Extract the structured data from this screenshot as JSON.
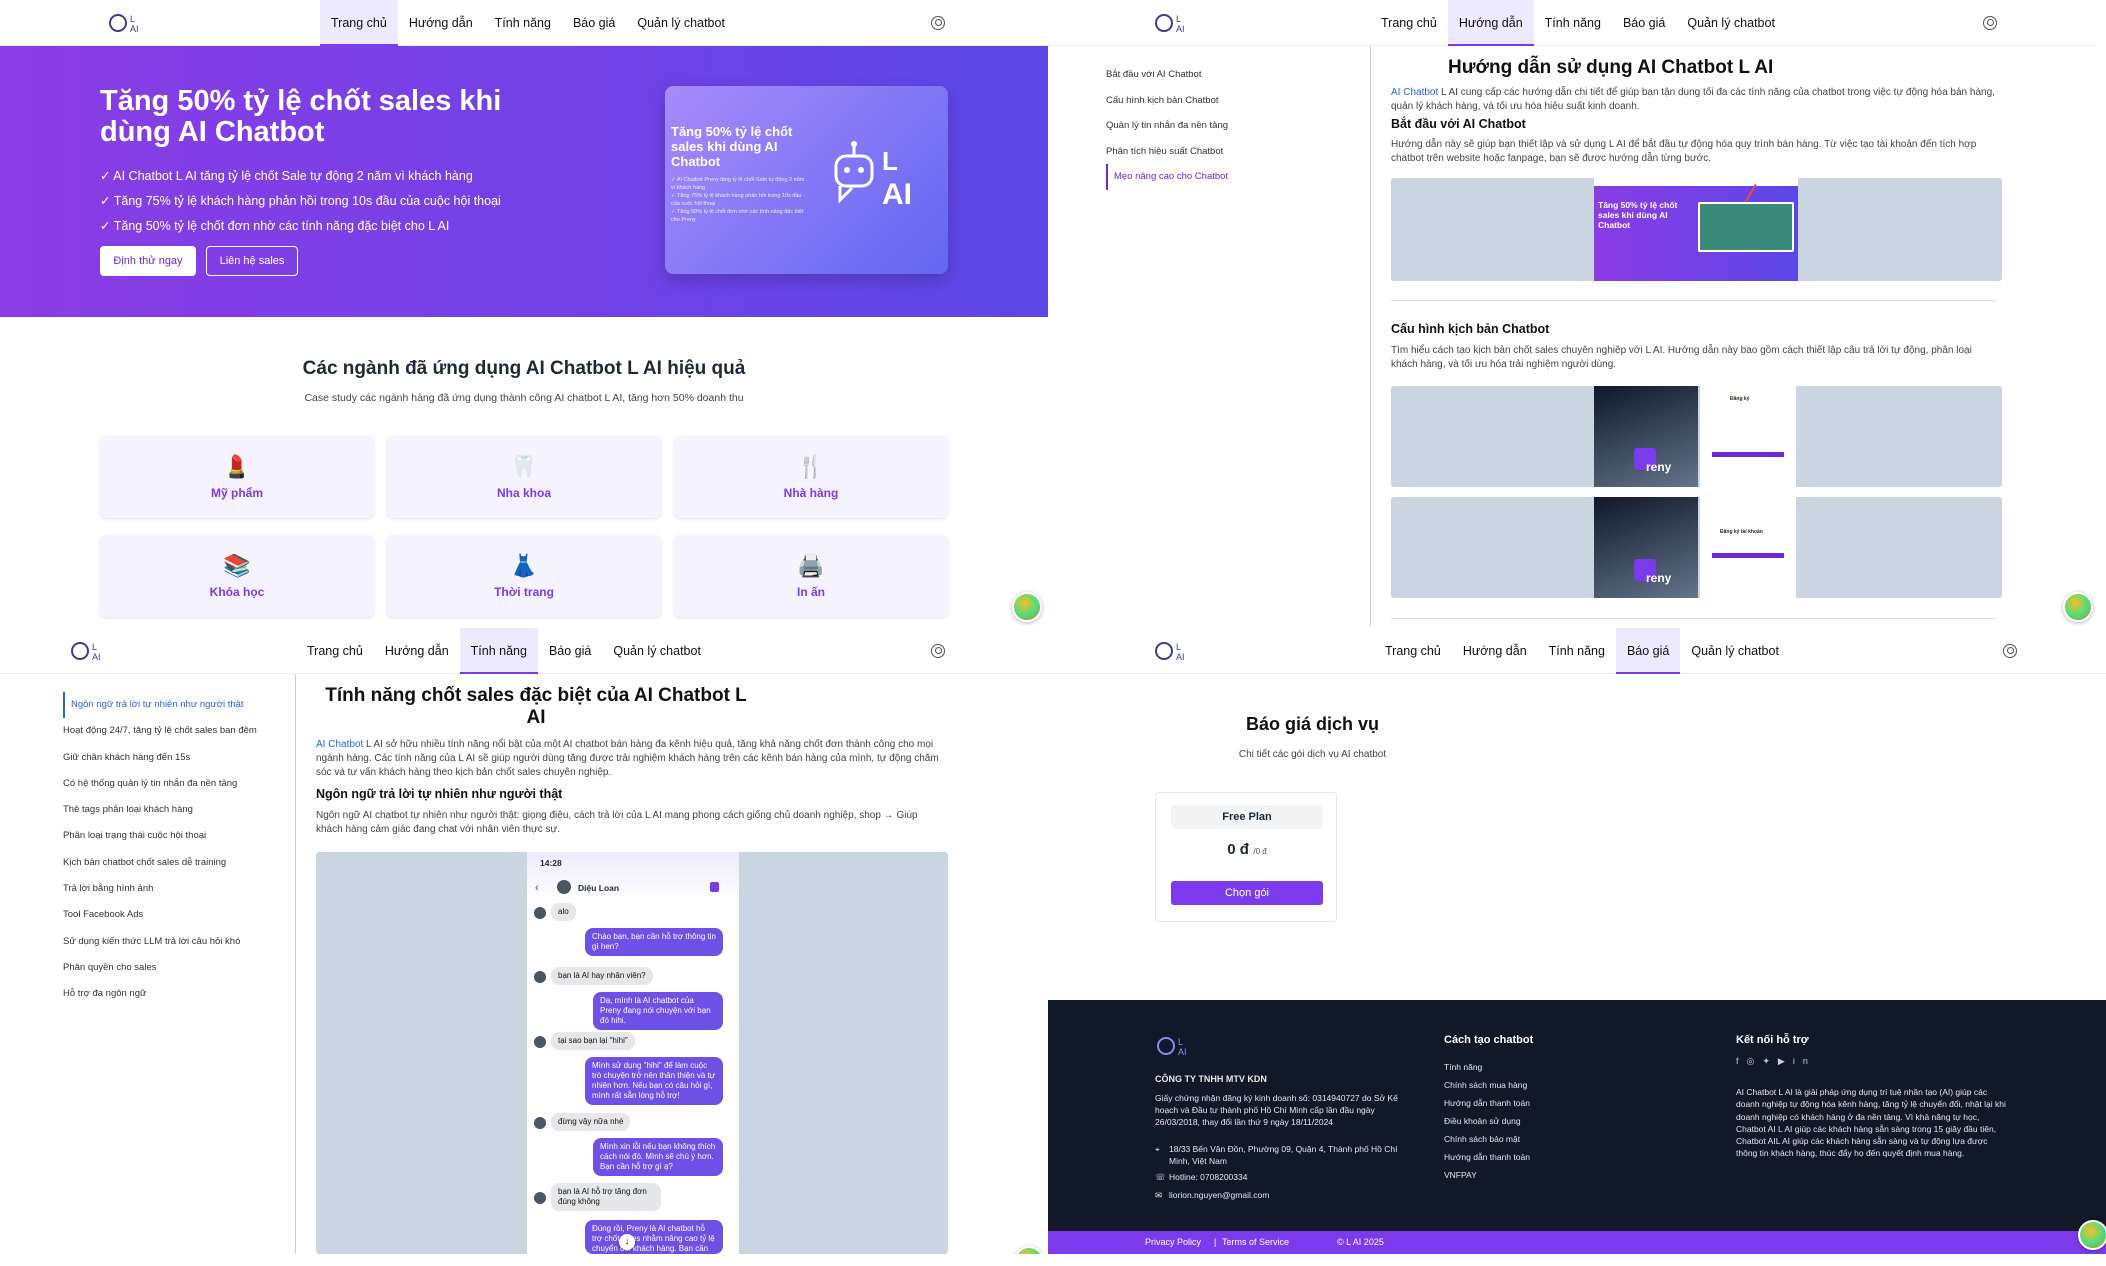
{
  "nav": {
    "home": "Trang chủ",
    "guide": "Hướng dẫn",
    "features": "Tính năng",
    "pricing": "Báo giá",
    "manage": "Quản lý chatbot"
  },
  "home": {
    "hero_title": "Tăng 50% tỷ lệ chốt sales khi dùng AI Chatbot",
    "checks": [
      "AI Chatbot L AI tăng tỷ lệ chốt Sale tự động 2 năm vì khách hàng",
      "Tăng 75% tỷ lệ khách hàng phản hồi trong 10s đầu của cuộc hội thoại",
      "Tăng 50% tỷ lệ chốt đơn nhờ các tính năng đặc biệt cho L AI"
    ],
    "cta_try": "Định thử ngay",
    "cta_contact": "Liên hệ sales",
    "card_title": "Tăng 50% tỷ lệ chốt sales khi dùng AI Chatbot",
    "card_lines": [
      "✓ AI Chatbot Preny tăng tỷ lệ chốt Sale tự động 2 năm vì khách hàng",
      "✓ Tăng 75% tỷ lệ khách hàng phản hồi trong 10s đầu của cuộc hội thoại",
      "✓ Tăng 50% tỷ lệ chốt đơn nhờ các tính năng đặc biệt cho Preny"
    ],
    "card_logo_l": "L",
    "card_logo_ai": "AI",
    "section_title": "Các ngành đã ứng dụng AI Chatbot L AI hiệu quả",
    "section_sub": "Case study các ngành hàng đã ứng dụng thành công AI chatbot L AI, tăng hơn 50% doanh thu",
    "industries": [
      {
        "icon": "💄",
        "label": "Mỹ phẩm"
      },
      {
        "icon": "🦷",
        "label": "Nha khoa"
      },
      {
        "icon": "🍴",
        "label": "Nhà hàng"
      },
      {
        "icon": "📚",
        "label": "Khóa học"
      },
      {
        "icon": "👗",
        "label": "Thời trang"
      },
      {
        "icon": "🖨️",
        "label": "In ấn"
      }
    ]
  },
  "guide": {
    "sidebar": [
      "Bắt đầu với AI Chatbot",
      "Cấu hình kịch bản Chatbot",
      "Quản lý tin nhắn đa nền tảng",
      "Phân tích hiệu suất Chatbot",
      "Mẹo nâng cao cho Chatbot"
    ],
    "title": "Hướng dẫn sử dụng AI Chatbot L AI",
    "intro_link": "AI Chatbot",
    "intro": " L AI cung cấp các hướng dẫn chi tiết để giúp bạn tận dụng tối đa các tính năng của chatbot trong việc tự động hóa bán hàng, quản lý khách hàng, và tối ưu hóa hiệu suất kinh doanh.",
    "s1_title": "Bắt đầu với AI Chatbot",
    "s1_text": "Hướng dẫn này sẽ giúp bạn thiết lập và sử dụng L AI để bắt đầu tự động hóa quy trình bán hàng. Từ việc tạo tài khoản đến tích hợp chatbot trên website hoặc fanpage, bạn sẽ được hướng dẫn từng bước.",
    "s1_img_title": "Tăng 50% tỷ lệ chốt sales khi dùng AI Chatbot",
    "s2_title": "Cấu hình kịch bản Chatbot",
    "s2_text": "Tìm hiểu cách tạo kịch bản chốt sales chuyên nghiệp với L AI. Hướng dẫn này bao gồm cách thiết lập câu trả lời tự động, phân loại khách hàng, và tối ưu hóa trải nghiệm người dùng.",
    "brand_img": "reny",
    "form1": "Đăng ký",
    "form2": "Đăng ký tài khoản"
  },
  "features": {
    "sidebar": [
      "Ngôn ngữ trả lời tự nhiên như người thật",
      "Hoạt động 24/7, tăng tỷ lệ chốt sales ban đêm",
      "Giữ chân khách hàng đến 15s",
      "Có hệ thống quản lý tin nhắn đa nền tảng",
      "Thẻ tags phân loại khách hàng",
      "Phân loại trạng thái cuộc hội thoại",
      "Kịch bản chatbot chốt sales dễ training",
      "Trả lời bằng hình ảnh",
      "Tool Facebook Ads",
      "Sử dụng kiến thức LLM trả lời câu hỏi khó",
      "Phân quyền cho sales",
      "Hỗ trợ đa ngôn ngữ"
    ],
    "title": "Tính năng chốt sales đặc biệt của AI Chatbot L AI",
    "intro_link": "AI Chatbot",
    "intro": " L AI sở hữu nhiều tính năng nổi bật của một AI chatbot bán hàng đa kênh hiệu quả, tăng khả năng chốt đơn thành công cho mọi ngành hàng. Các tính năng của L AI sẽ giúp người dùng tăng được trải nghiệm khách hàng trên các kênh bán hàng của mình, tự động chăm sóc và tư vấn khách hàng theo kịch bản chốt sales chuyên nghiệp.",
    "s1_title": "Ngôn ngữ trả lời tự nhiên như người thật",
    "s1_text": "Ngôn ngữ AI chatbot tự nhiên như người thật: giọng điệu, cách trả lời của L AI mang phong cách giống chủ doanh nghiệp, shop → Giúp khách hàng cảm giác đang chat với nhân viên thực sự.",
    "phone": {
      "time": "14:28",
      "contact": "Diệu Loan",
      "messages": [
        {
          "from": "u",
          "text": "alo"
        },
        {
          "from": "b",
          "text": "Chào bạn, bạn cần hỗ trợ thông tin gì hen?"
        },
        {
          "from": "u",
          "text": "bạn là AI hay nhân viên?"
        },
        {
          "from": "b",
          "text": "Dạ, mình là AI chatbot của Preny đang nói chuyện với bạn đó hihi."
        },
        {
          "from": "u",
          "text": "tại sao bạn lại \"hihi\""
        },
        {
          "from": "b",
          "text": "Mình sử dụng \"hihi\" để làm cuộc trò chuyện trở nên thân thiện và tự nhiên hơn. Nếu bạn có câu hỏi gì, mình rất sẵn lòng hỗ trợ!"
        },
        {
          "from": "u",
          "text": "đừng vậy nữa nhé"
        },
        {
          "from": "b",
          "text": "Mình xin lỗi nếu bạn không thích cách nói đó. Mình sẽ chú ý hơn. Bạn cần hỗ trợ gì ạ?"
        },
        {
          "from": "u",
          "text": "bạn là AI hỗ trợ tăng đơn đúng không"
        },
        {
          "from": "b",
          "text": "Đúng rồi, Preny là AI chatbot hỗ trợ chốt sales nhằm nâng cao tỷ lệ chuyển đổi khách hàng. Bạn cần tìm hiểu thêm về dịch vụ nào cụ thể không ạ?"
        }
      ]
    }
  },
  "pricing": {
    "title": "Báo giá dịch vụ",
    "subtitle": "Chi tiết các gói dịch vụ AI chatbot",
    "plan_name": "Free Plan",
    "plan_price": "0 đ",
    "plan_period": "/0 đ",
    "plan_btn": "Chọn gói"
  },
  "footer": {
    "company": "CÔNG TY TNHH MTV KDN",
    "license": "Giấy chứng nhận đăng ký kinh doanh số: 0314940727 do Sở Kế hoạch và Đầu tư thành phố Hồ Chí Minh cấp lần đầu ngày 26/03/2018, thay đổi lần thứ 9 ngày 18/11/2024",
    "address": "18/33 Bến Vân Đồn, Phường 09, Quận 4, Thành phố Hồ Chí Minh, Việt Nam",
    "hotline": "Hotline: 0708200334",
    "email": "liorion.nguyen@gmail.com",
    "col2_title": "Cách tạo chatbot",
    "col2_links": [
      "Tính năng",
      "Chính sách mua hàng",
      "Hướng dẫn thanh toán",
      "Điều khoản sử dụng",
      "Chính sách bảo mật",
      "Hướng dẫn thanh toán",
      "VNFPAY"
    ],
    "col3_title": "Kết nối hỗ trợ",
    "col3_text": "AI Chatbot L AI là giải pháp ứng dụng trí tuệ nhân tạo (AI) giúp các doanh nghiệp tự động hóa kênh hàng, tăng tỷ lệ chuyển đổi, nhật lại khi doanh nghiệp có khách hàng ở đa nền tảng. Vì khả năng tự học, Chatbot AI L AI giúp các khách hàng sẵn sàng trong 15 giây đầu tiên, Chatbot AIL AI giúp các khách hàng sẵn sàng và tự động lựa được thông tin khách hàng, thúc đẩy họ đến quyết định mua hàng.",
    "privacy": "Privacy Policy",
    "terms": "Terms of Service",
    "copyright": "© L AI 2025"
  }
}
